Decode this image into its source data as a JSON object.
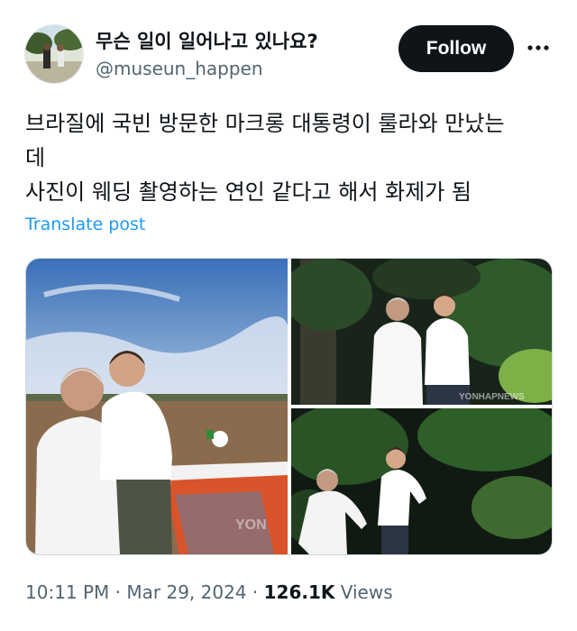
{
  "author": {
    "display_name": "무슨 일이 일어나고 있나요?",
    "handle": "@museun_happen"
  },
  "follow_label": "Follow",
  "more_icon": "more-horizontal-icon",
  "post": {
    "lines": [
      "브라질에 국빈 방문한 마크롱 대통령이 룰라와 만났는",
      "데",
      "사진이 웨딩 촬영하는 연인 같다고 해서 화제가 됨"
    ]
  },
  "translate_label": "Translate post",
  "media": {
    "watermark_text": "YONHAPNEWS"
  },
  "meta": {
    "time": "10:11 PM",
    "separator": "·",
    "date": "Mar 29, 2024",
    "views_count": "126.1K",
    "views_label": "Views"
  },
  "colors": {
    "follow_bg": "#0f1419",
    "link": "#1d9bf0",
    "secondary_text": "#536471"
  }
}
